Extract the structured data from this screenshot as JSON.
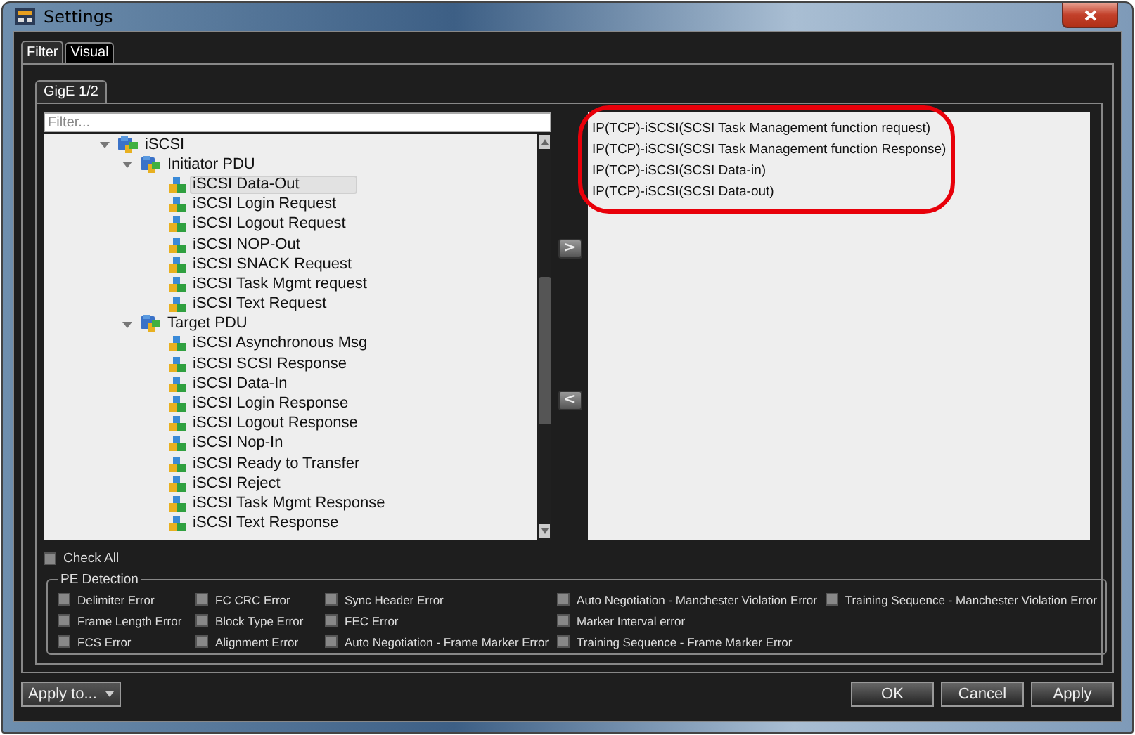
{
  "window": {
    "title": "Settings"
  },
  "tabs": [
    {
      "label": "Filter",
      "selected": true
    },
    {
      "label": "Visual",
      "selected": false
    }
  ],
  "sub_tabs": [
    {
      "label": "GigE 1/2",
      "selected": true
    }
  ],
  "filter": {
    "placeholder": "Filter..."
  },
  "tree": {
    "items": [
      {
        "label": "iSCSI",
        "expanded": true,
        "selected": false,
        "children": [
          {
            "label": "Initiator PDU",
            "expanded": true,
            "selected": false,
            "children": [
              {
                "label": "iSCSI Data-Out",
                "selected": true
              },
              {
                "label": "iSCSI Login Request",
                "selected": false
              },
              {
                "label": "iSCSI Logout Request",
                "selected": false
              },
              {
                "label": "iSCSI NOP-Out",
                "selected": false
              },
              {
                "label": "iSCSI SNACK Request",
                "selected": false
              },
              {
                "label": "iSCSI Task Mgmt request",
                "selected": false
              },
              {
                "label": "iSCSI Text Request",
                "selected": false
              }
            ]
          },
          {
            "label": "Target PDU",
            "expanded": true,
            "selected": false,
            "children": [
              {
                "label": "iSCSI Asynchronous Msg",
                "selected": false
              },
              {
                "label": "iSCSI SCSI Response",
                "selected": false
              },
              {
                "label": "iSCSI Data-In",
                "selected": false
              },
              {
                "label": "iSCSI Login Response",
                "selected": false
              },
              {
                "label": "iSCSI Logout Response",
                "selected": false
              },
              {
                "label": "iSCSI Nop-In",
                "selected": false
              },
              {
                "label": "iSCSI Ready to Transfer",
                "selected": false
              },
              {
                "label": "iSCSI Reject",
                "selected": false
              },
              {
                "label": "iSCSI Task Mgmt Response",
                "selected": false
              },
              {
                "label": "iSCSI Text Response",
                "selected": false
              }
            ]
          }
        ]
      }
    ]
  },
  "move_buttons": [
    {
      "symbol": ">"
    },
    {
      "symbol": "<"
    }
  ],
  "selected_filters": [
    "IP(TCP)-iSCSI(SCSI Task Management function request)",
    "IP(TCP)-iSCSI(SCSI Task Management function Response)",
    "IP(TCP)-iSCSI(SCSI Data-in)",
    "IP(TCP)-iSCSI(SCSI Data-out)"
  ],
  "check_all": {
    "label": "Check All",
    "checked": false
  },
  "pe_detection": {
    "title": "PE Detection",
    "columns": [
      [
        {
          "label": "Delimiter Error",
          "checked": false
        },
        {
          "label": "Frame Length Error",
          "checked": false
        },
        {
          "label": "FCS Error",
          "checked": false
        }
      ],
      [
        {
          "label": "FC CRC Error",
          "checked": false
        },
        {
          "label": "Block Type Error",
          "checked": false
        },
        {
          "label": "Alignment Error",
          "checked": false
        }
      ],
      [
        {
          "label": "Sync Header Error",
          "checked": false
        },
        {
          "label": "FEC Error",
          "checked": false
        },
        {
          "label": "Auto Negotiation - Frame Marker Error",
          "checked": false
        }
      ],
      [
        {
          "label": "Auto Negotiation - Manchester Violation Error",
          "checked": false
        },
        {
          "label": "Marker Interval error",
          "checked": false
        },
        {
          "label": "Training Sequence - Frame Marker Error",
          "checked": false
        }
      ],
      [
        {
          "label": "Training Sequence - Manchester Violation Error",
          "checked": false
        }
      ]
    ]
  },
  "apply_to": {
    "label": "Apply to..."
  },
  "buttons": [
    "OK",
    "Cancel",
    "Apply"
  ]
}
